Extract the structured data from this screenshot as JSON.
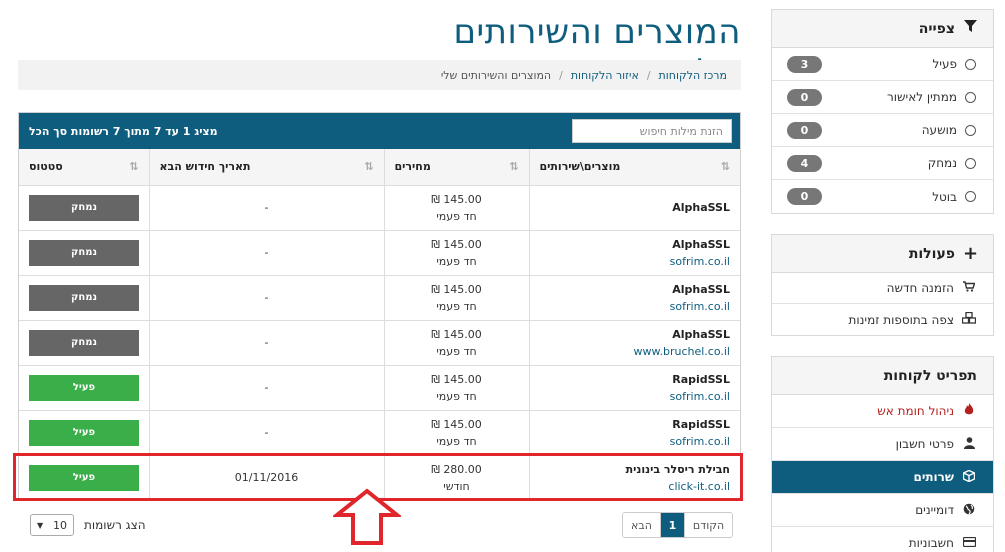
{
  "page": {
    "title": "המוצרים והשירותים שלי"
  },
  "breadcrumb": [
    {
      "label": "מרכז הלקוחות",
      "link": true
    },
    {
      "label": "איזור הלקוחות",
      "link": true
    },
    {
      "label": "המוצרים והשירותים שלי",
      "link": false
    }
  ],
  "filter_panel": {
    "title": "צפייה",
    "icon": "filter-icon",
    "items": [
      {
        "label": "פעיל",
        "count": "3"
      },
      {
        "label": "ממתין לאישור",
        "count": "0"
      },
      {
        "label": "מושעה",
        "count": "0"
      },
      {
        "label": "נמחק",
        "count": "4"
      },
      {
        "label": "בוטל",
        "count": "0"
      }
    ]
  },
  "actions_panel": {
    "title": "פעולות",
    "icon": "plus-icon",
    "items": [
      {
        "label": "הזמנה חדשה",
        "icon": "cart-icon"
      },
      {
        "label": "צפה בתוספות זמינות",
        "icon": "cubes-icon"
      }
    ]
  },
  "customer_menu": {
    "title": "תפריט לקוחות",
    "items": [
      {
        "label": "ניהול חומת אש",
        "icon": "fire-icon",
        "state": "danger"
      },
      {
        "label": "פרטי חשבון",
        "icon": "user-icon",
        "state": "normal"
      },
      {
        "label": "שרותים",
        "icon": "cube-icon",
        "state": "active"
      },
      {
        "label": "דומיינים",
        "icon": "globe-icon",
        "state": "normal"
      },
      {
        "label": "חשבוניות",
        "icon": "credit-card-icon",
        "state": "normal"
      }
    ]
  },
  "table": {
    "info": "מציג 1 עד 7 מתוך 7 רשומות סך הכל",
    "search_placeholder": "הזנת מילות חיפוש",
    "columns": {
      "product": "מוצרים\\שירותים",
      "price": "מחירים",
      "renew": "תאריך חידוש הבא",
      "status": "סטטוס"
    },
    "rows": [
      {
        "name": "AlphaSSL",
        "domain": "",
        "price": "145.00 ₪",
        "cycle": "חד פעמי",
        "renew": "-",
        "status": "נמחק",
        "status_color": "gray"
      },
      {
        "name": "AlphaSSL",
        "domain": "sofrim.co.il",
        "price": "145.00 ₪",
        "cycle": "חד פעמי",
        "renew": "-",
        "status": "נמחק",
        "status_color": "gray"
      },
      {
        "name": "AlphaSSL",
        "domain": "sofrim.co.il",
        "price": "145.00 ₪",
        "cycle": "חד פעמי",
        "renew": "-",
        "status": "נמחק",
        "status_color": "gray"
      },
      {
        "name": "AlphaSSL",
        "domain": "www.bruchel.co.il",
        "price": "145.00 ₪",
        "cycle": "חד פעמי",
        "renew": "-",
        "status": "נמחק",
        "status_color": "gray"
      },
      {
        "name": "RapidSSL",
        "domain": "sofrim.co.il",
        "price": "145.00 ₪",
        "cycle": "חד פעמי",
        "renew": "-",
        "status": "פעיל",
        "status_color": "green"
      },
      {
        "name": "RapidSSL",
        "domain": "sofrim.co.il",
        "price": "145.00 ₪",
        "cycle": "חד פעמי",
        "renew": "-",
        "status": "פעיל",
        "status_color": "green"
      },
      {
        "name": "חבילת ריסלר בינונית",
        "domain": "click-it.co.il",
        "price": "280.00 ₪",
        "cycle": "חודשי",
        "renew": "01/11/2016",
        "status": "פעיל",
        "status_color": "green"
      }
    ]
  },
  "pagination": {
    "prev": "הקודם",
    "current": "1",
    "next": "הבא"
  },
  "page_length": {
    "label": "הצג רשומות",
    "value": "10"
  },
  "colors": {
    "brand": "#0e5d7e",
    "active_status": "#3aae49",
    "deleted_status": "#666666",
    "highlight": "#e0252b"
  }
}
